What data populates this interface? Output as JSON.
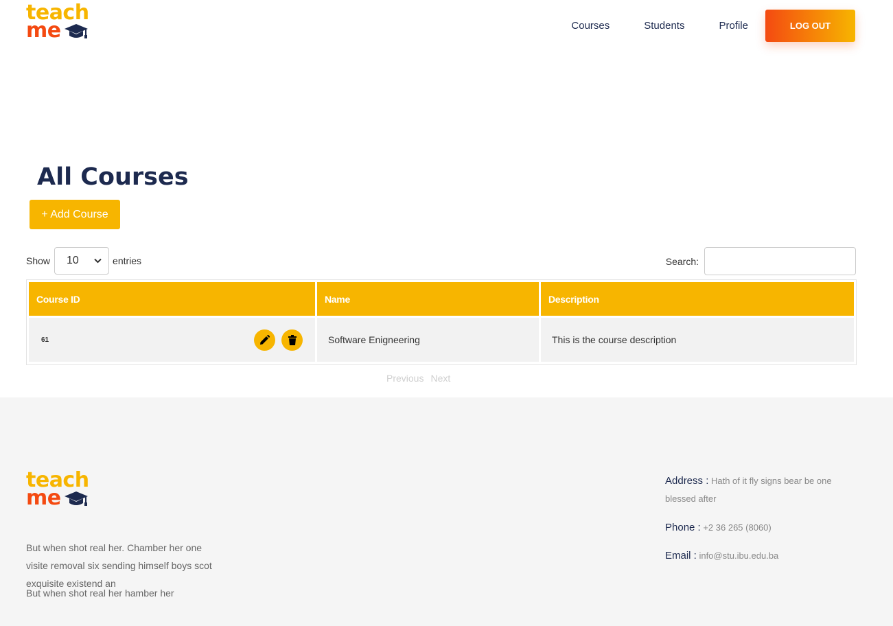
{
  "logo": {
    "line1": "teach",
    "line2": "me"
  },
  "nav": {
    "items": [
      {
        "label": "Courses"
      },
      {
        "label": "Students"
      },
      {
        "label": "Profile"
      }
    ],
    "logout_label": "LOG OUT"
  },
  "main": {
    "title": "All Courses",
    "add_button_label": "+ Add Course",
    "show_label": "Show",
    "entries_value": "10",
    "entries_label": "entries",
    "search_label": "Search:",
    "search_value": "",
    "table": {
      "columns": [
        "Course ID",
        "Name",
        "Description"
      ],
      "rows": [
        {
          "id": "61",
          "name": "Software Enigneering",
          "description": "This is the course description"
        }
      ]
    },
    "pager": {
      "previous_label": "Previous",
      "next_label": "Next"
    }
  },
  "footer": {
    "text1": "But when shot real her. Chamber her one visite removal six sending himself boys scot exquisite existend an",
    "text2": "But when shot real her hamber her",
    "address_label": "Address :",
    "address_value": " Hath of it fly signs bear be one blessed after",
    "phone_label": "Phone :",
    "phone_value": " +2 36 265 (8060)",
    "email_label": "Email :",
    "email_value": " info@stu.ibu.edu.ba"
  },
  "colors": {
    "accent": "#f7b500",
    "brand_orange": "#f44a11",
    "navy": "#1d2a4f",
    "footer_bg": "#f5f5f5"
  },
  "icons": {
    "logo": "graduation-cap-icon",
    "edit": "pencil-icon",
    "delete": "trash-icon",
    "select": "chevron-down-icon"
  }
}
